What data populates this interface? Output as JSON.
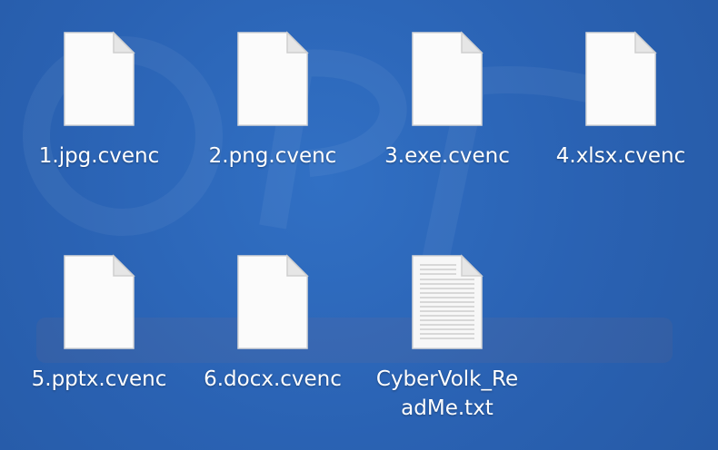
{
  "desktop": {
    "background_color": "#2b63b5",
    "files": [
      {
        "name": "1.jpg.cvenc",
        "icon": "blank-file-icon"
      },
      {
        "name": "2.png.cvenc",
        "icon": "blank-file-icon"
      },
      {
        "name": "3.exe.cvenc",
        "icon": "blank-file-icon"
      },
      {
        "name": "4.xlsx.cvenc",
        "icon": "blank-file-icon"
      },
      {
        "name": "5.pptx.cvenc",
        "icon": "blank-file-icon"
      },
      {
        "name": "6.docx.cvenc",
        "icon": "blank-file-icon"
      },
      {
        "name": "CyberVolk_Re\nadMe.txt",
        "icon": "text-document-icon"
      }
    ]
  }
}
